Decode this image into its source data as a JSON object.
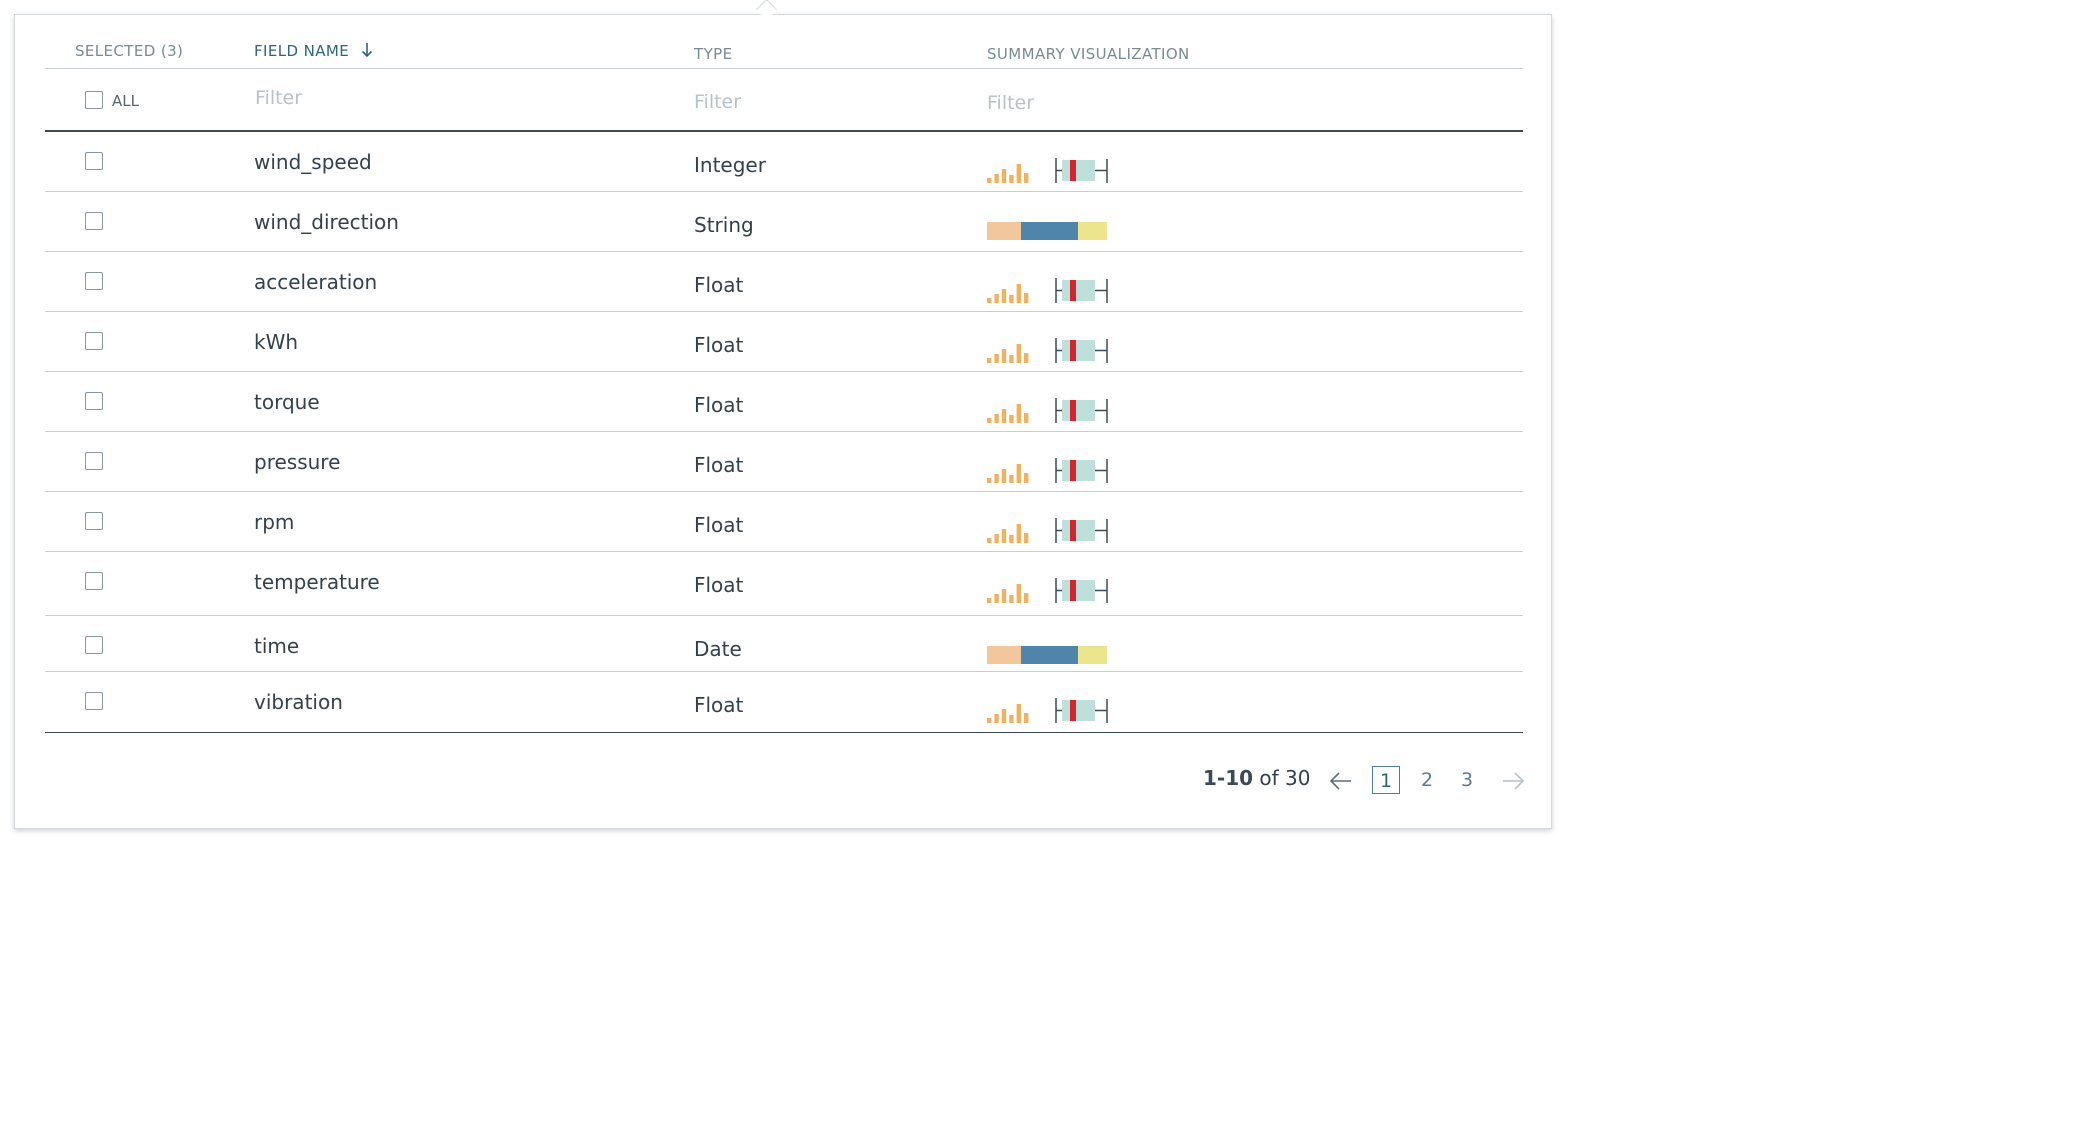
{
  "header": {
    "selected_label": "SELECTED (3)",
    "field_name_label": "FIELD NAME",
    "type_label": "TYPE",
    "summary_label": "SUMMARY VISUALIZATION",
    "sort_icon": "arrow-down-icon"
  },
  "filters": {
    "all_label": "ALL",
    "field_placeholder": "Filter",
    "type_placeholder": "Filter",
    "summary_placeholder": "Filter"
  },
  "rows": [
    {
      "name": "wind_speed",
      "type": "Integer",
      "viz": "histogram-boxplot"
    },
    {
      "name": "wind_direction",
      "type": "String",
      "viz": "category-bar"
    },
    {
      "name": "acceleration",
      "type": "Float",
      "viz": "histogram-boxplot"
    },
    {
      "name": "kWh",
      "type": "Float",
      "viz": "histogram-boxplot"
    },
    {
      "name": "torque",
      "type": "Float",
      "viz": "histogram-boxplot"
    },
    {
      "name": "pressure",
      "type": "Float",
      "viz": "histogram-boxplot"
    },
    {
      "name": "rpm",
      "type": "Float",
      "viz": "histogram-boxplot"
    },
    {
      "name": "temperature",
      "type": "Float",
      "viz": "histogram-boxplot"
    },
    {
      "name": "time",
      "type": "Date",
      "viz": "category-bar"
    },
    {
      "name": "vibration",
      "type": "Float",
      "viz": "histogram-boxplot"
    }
  ],
  "pagination": {
    "range": "1-10",
    "of_label": "of 30",
    "pages": [
      "1",
      "2",
      "3"
    ],
    "current_page": "1",
    "prev_icon": "arrow-left-icon",
    "next_icon": "arrow-right-icon"
  },
  "colors": {
    "histogram_bar": "#f0b160",
    "box_fill": "#bfe0da",
    "median": "#d0262f",
    "whisker": "#3b4a55",
    "cat_1": "#f3c79d",
    "cat_2": "#4f85ab",
    "cat_3": "#ede58e"
  }
}
